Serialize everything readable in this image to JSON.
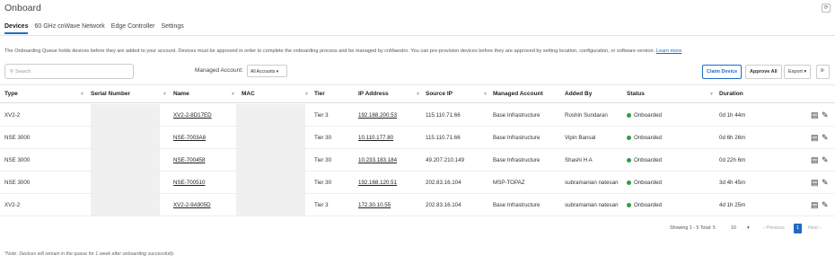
{
  "page": {
    "title": "Onboard"
  },
  "tabs": [
    "Devices",
    "60 GHz cnWave Network",
    "Edge Controller",
    "Settings"
  ],
  "info": {
    "text": "The Onboarding Queue holds devices before they are added to your account. Devices must be approved in order to complete the onboarding process and be managed by cnMaestro. You can pre-provision devices before they are approved by setting location, configuration, or software version.",
    "link": "Learn more"
  },
  "toolbar": {
    "search_placeholder": "Search",
    "managed_label": "Managed Account:",
    "managed_value": "All Accounts ▾",
    "claim": "Claim Device",
    "approve_all": "Approve All",
    "export": "Export ▾",
    "columns_icon": "⊪"
  },
  "columns": [
    "Type",
    "Serial Number",
    "Name",
    "MAC",
    "Tier",
    "IP Address",
    "Source IP",
    "Managed Account",
    "Added By",
    "Status",
    "Duration"
  ],
  "rows": [
    {
      "type": "XV2-2",
      "name": "XV2-2-8D17ED",
      "tier": "Tier 3",
      "ip": "192.168.200.53",
      "source_ip": "115.110.71.66",
      "account": "Base Infrastructure",
      "added_by": "Roshin Sundaran",
      "status": "Onboarded",
      "duration": "0d 1h 44m"
    },
    {
      "type": "NSE 3000",
      "name": "NSE-7003A8",
      "tier": "Tier 30",
      "ip": "10.110.177.80",
      "source_ip": "115.110.71.66",
      "account": "Base Infrastructure",
      "added_by": "Vipin Bansal",
      "status": "Onboarded",
      "duration": "0d 6h 26m"
    },
    {
      "type": "NSE 3000",
      "name": "NSE-700458",
      "tier": "Tier 30",
      "ip": "10.233.183.184",
      "source_ip": "49.207.210.149",
      "account": "Base Infrastructure",
      "added_by": "Shashi H A",
      "status": "Onboarded",
      "duration": "0d 22h 6m"
    },
    {
      "type": "NSE 3000",
      "name": "NSE-700510",
      "tier": "Tier 30",
      "ip": "192.168.120.51",
      "source_ip": "202.83.16.104",
      "account": "MSP-TOPAZ",
      "added_by": "subramanian natesan",
      "status": "Onboarded",
      "duration": "3d 4h 45m"
    },
    {
      "type": "XV2-2",
      "name": "XV2-2-9A905D",
      "tier": "Tier 3",
      "ip": "172.30.10.55",
      "source_ip": "202.83.16.104",
      "account": "Base Infrastructure",
      "added_by": "subramanian natesan",
      "status": "Onboarded",
      "duration": "4d 1h 25m"
    }
  ],
  "pagination": {
    "showing": "Showing 1 - 5 Total: 5",
    "page_size": "10",
    "page_size_arrow": "▾",
    "previous": "‹ Previous",
    "current": "1",
    "next": "Next ›"
  },
  "note": "*Note: Devices will remain in the queue for 1 week after onboarding successfully.",
  "colors": {
    "accent": "#1f6bc4",
    "onboarded": "#2e9e46"
  }
}
